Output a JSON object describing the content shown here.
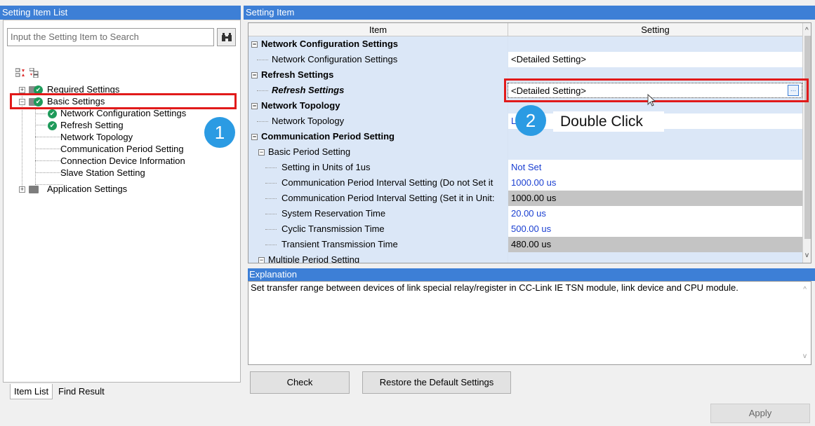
{
  "left_panel": {
    "title": "Setting Item List",
    "search_placeholder": "Input the Setting Item to Search",
    "tree": [
      {
        "label": "Required Settings"
      },
      {
        "label": "Basic Settings"
      },
      {
        "label": "Network Configuration Settings"
      },
      {
        "label": "Refresh Setting"
      },
      {
        "label": "Network Topology"
      },
      {
        "label": "Communication Period Setting"
      },
      {
        "label": "Connection Device Information"
      },
      {
        "label": "Slave Station Setting"
      },
      {
        "label": "Application Settings"
      }
    ],
    "tabs": [
      {
        "label": "Item List"
      },
      {
        "label": "Find Result"
      }
    ]
  },
  "right_panel": {
    "title": "Setting Item",
    "columns": {
      "item": "Item",
      "setting": "Setting"
    },
    "rows": [
      {
        "item": "Network Configuration Settings",
        "setting": ""
      },
      {
        "item": "Network Configuration Settings",
        "setting": "<Detailed Setting>"
      },
      {
        "item": "Refresh Settings",
        "setting": ""
      },
      {
        "item": "Refresh Settings",
        "setting": "<Detailed Setting>"
      },
      {
        "item": "Network Topology",
        "setting": ""
      },
      {
        "item": "Network Topology",
        "setting": "L"
      },
      {
        "item": "Communication Period Setting",
        "setting": ""
      },
      {
        "item": "Basic Period Setting",
        "setting": ""
      },
      {
        "item": "Setting in Units of 1us",
        "setting": "Not Set"
      },
      {
        "item": "Communication Period Interval Setting (Do not Set it",
        "setting": "1000.00 us"
      },
      {
        "item": "Communication Period Interval Setting (Set it in Unit:",
        "setting": "1000.00 us"
      },
      {
        "item": "System Reservation Time",
        "setting": "20.00 us"
      },
      {
        "item": "Cyclic Transmission Time",
        "setting": "500.00 us"
      },
      {
        "item": "Transient Transmission Time",
        "setting": "480.00 us"
      },
      {
        "item": "Multiple Period Setting",
        "setting": ""
      }
    ],
    "ellipsis_button": "...",
    "explanation_title": "Explanation",
    "explanation_text": "Set transfer range between devices of link special relay/register in CC-Link IE TSN module, link device and CPU module.",
    "check_button": "Check",
    "restore_button": "Restore the Default Settings",
    "apply_button": "Apply"
  },
  "annotations": {
    "marker_1": "1",
    "marker_2": "2",
    "double_click_text": "Double Click"
  },
  "colors": {
    "header_blue": "#3d7fd6",
    "row_blue": "#dbe7f7",
    "highlight_red": "#e11a1a",
    "marker_blue": "#2b9be3",
    "value_blue": "#1a3fd1"
  }
}
